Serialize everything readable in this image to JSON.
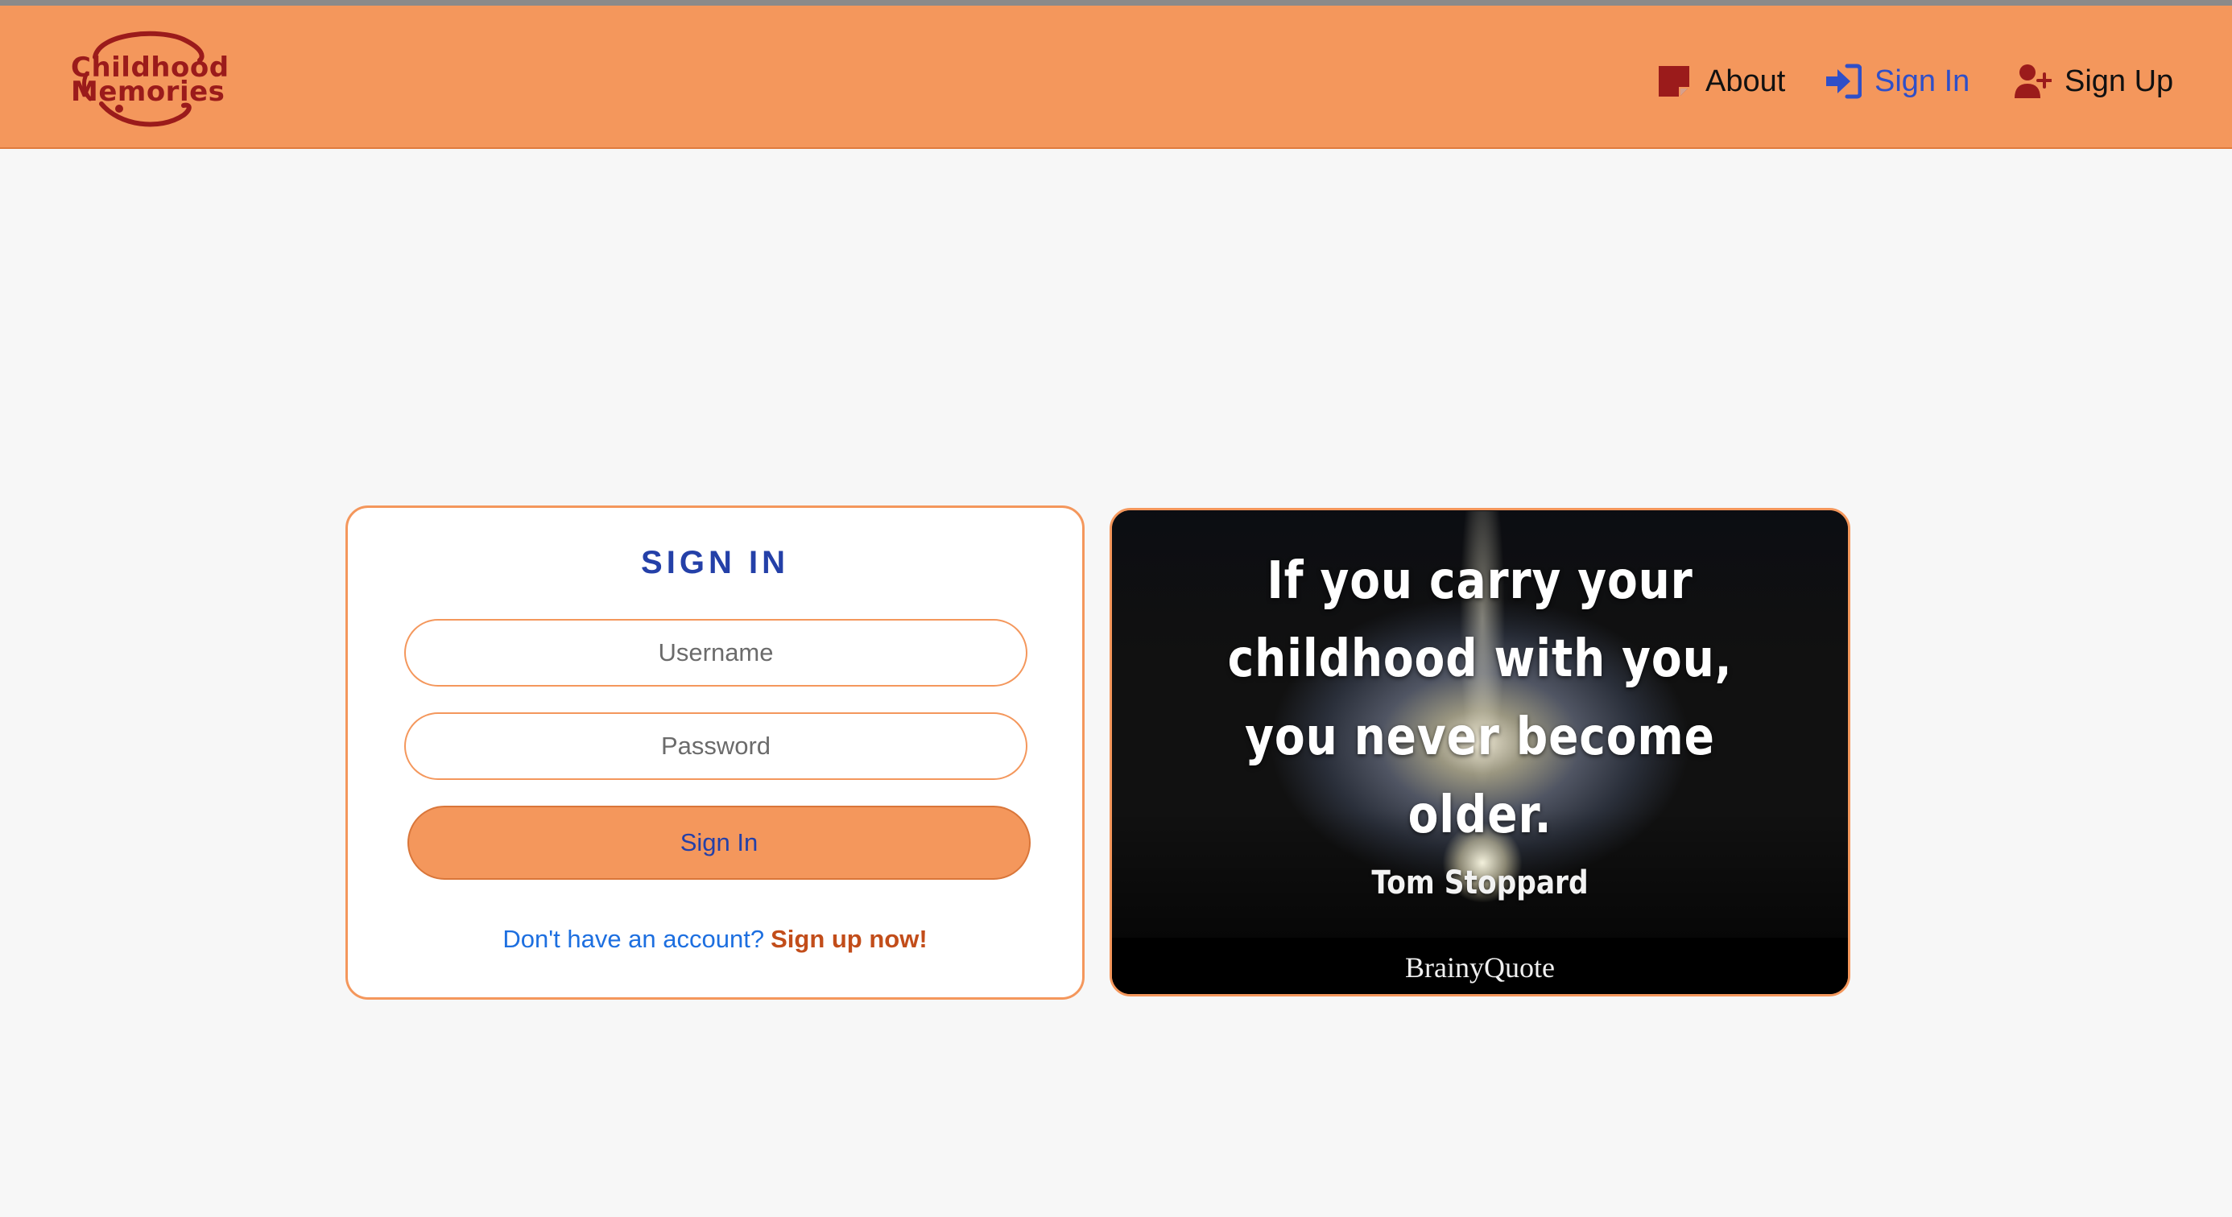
{
  "app": {
    "logo_line1": "Childhood",
    "logo_line2": "Memories"
  },
  "nav": {
    "about": "About",
    "sign_in": "Sign In",
    "sign_up": "Sign Up"
  },
  "signin_form": {
    "title": "SIGN IN",
    "username_placeholder": "Username",
    "password_placeholder": "Password",
    "submit_label": "Sign In",
    "prompt_text": "Don't have an account?",
    "signup_link": "Sign up now!"
  },
  "quote_image": {
    "line1": "If you carry your",
    "line2": "childhood with you,",
    "line3": "you never become",
    "line4": "older.",
    "author": "Tom Stoppard",
    "brand": "BrainyQuote"
  },
  "colors": {
    "navbar": "#f4975c",
    "logo": "#9b1b1b",
    "accent_blue": "#2440a8",
    "link_blue": "#1d6fe0",
    "link_orange": "#c24d1a"
  },
  "icons": {
    "about": "note-icon",
    "sign_in": "sign-in-icon",
    "sign_up": "user-plus-icon"
  }
}
